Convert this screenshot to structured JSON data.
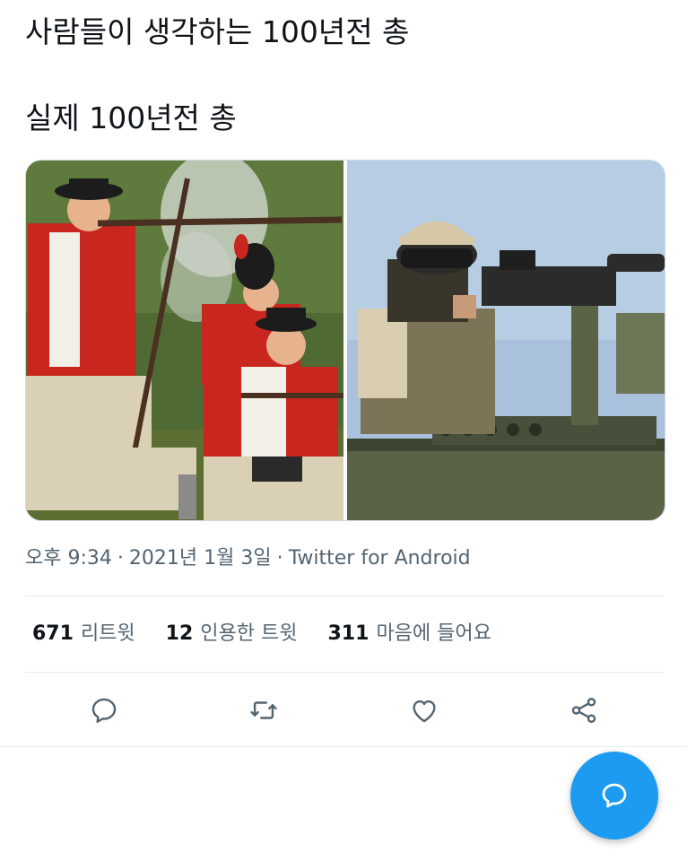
{
  "tweet": {
    "text_line1": "사람들이 생각하는 100년전 총",
    "text_line2": "실제 100년전 총"
  },
  "media": {
    "left_photo": "redcoat-musket-reenactment-photo",
    "right_photo": "soldier-mounted-machine-gun-photo"
  },
  "meta": {
    "time": "오후 9:34",
    "date": "2021년 1월 3일",
    "source": "Twitter for Android",
    "separator": "·"
  },
  "stats": {
    "retweets_count": "671",
    "retweets_label": "리트윗",
    "quotes_count": "12",
    "quotes_label": "인용한 트윗",
    "likes_count": "311",
    "likes_label": "마음에 들어요"
  },
  "actions": {
    "reply_icon": "reply-icon",
    "retweet_icon": "retweet-icon",
    "like_icon": "heart-icon",
    "share_icon": "share-icon"
  },
  "fab": {
    "icon": "compose-reply-icon",
    "color": "#1d9bf0"
  },
  "colors": {
    "text_primary": "#0f1419",
    "text_secondary": "#536471",
    "divider": "#e6ecf0",
    "icon": "#536471",
    "accent": "#1d9bf0"
  }
}
